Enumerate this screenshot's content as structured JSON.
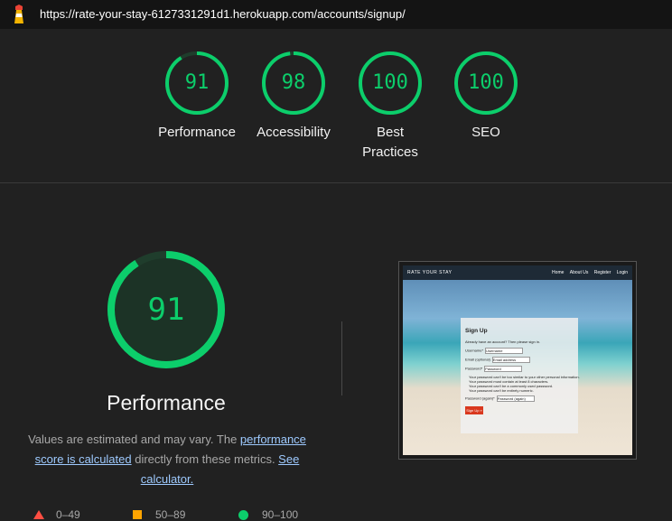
{
  "header": {
    "url": "https://rate-your-stay-6127331291d1.herokuapp.com/accounts/signup/"
  },
  "categories": [
    {
      "label": "Performance",
      "score": "91",
      "fraction": 0.91
    },
    {
      "label": "Accessibility",
      "score": "98",
      "fraction": 0.98
    },
    {
      "label": "Best Practices",
      "score": "100",
      "fraction": 1.0
    },
    {
      "label": "SEO",
      "score": "100",
      "fraction": 1.0
    }
  ],
  "performance": {
    "score": "91",
    "fraction": 0.91,
    "title": "Performance",
    "desc_1": "Values are estimated and may vary. The ",
    "link_1": "performance score is calculated",
    "desc_2": " directly from these metrics. ",
    "link_2": "See calculator.",
    "color": "#0cce6b"
  },
  "screenshot": {
    "brand": "RATE YOUR STAY",
    "nav": [
      "Home",
      "About Us",
      "Register",
      "Login"
    ],
    "heading": "Sign Up",
    "already": "Already have an account? Then please sign in.",
    "fields": [
      {
        "label": "Username*",
        "placeholder": "Username"
      },
      {
        "label": "Email (optional)",
        "placeholder": "Email address"
      },
      {
        "label": "Password*",
        "placeholder": "Password"
      }
    ],
    "rules": [
      "Your password can't be too similar to your other personal information.",
      "Your password must contain at least 8 characters.",
      "Your password can't be a commonly used password.",
      "Your password can't be entirely numeric."
    ],
    "confirm": {
      "label": "Password (again)*",
      "placeholder": "Password (again)"
    },
    "button": "Sign Up »"
  },
  "legend": [
    {
      "range": "0–49",
      "color": "#ff4e42"
    },
    {
      "range": "50–89",
      "color": "#ffa400"
    },
    {
      "range": "90–100",
      "color": "#0cce6b"
    }
  ]
}
